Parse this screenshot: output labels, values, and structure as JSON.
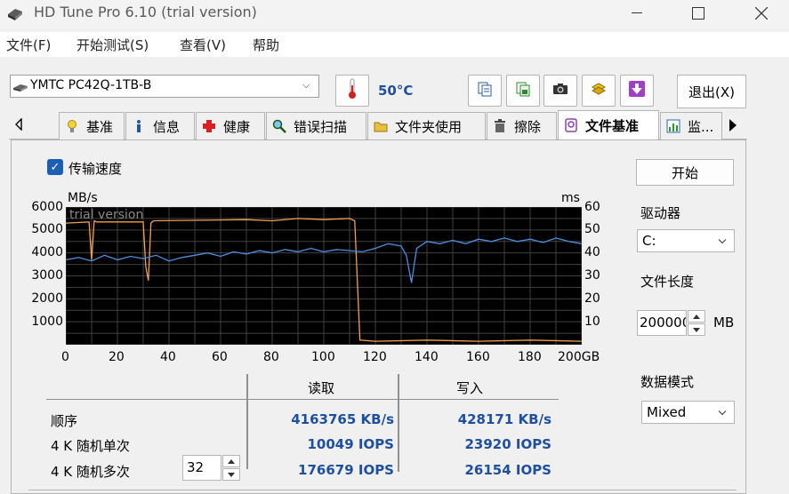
{
  "window": {
    "title": "HD Tune Pro 6.10 (trial version)",
    "minimize_icon": "minimize-icon",
    "maximize_icon": "maximize-icon",
    "close_icon": "close-icon"
  },
  "menu": [
    "文件(F)",
    "开始测试(S)",
    "查看(V)",
    "帮助"
  ],
  "toolbar": {
    "drive": "YMTC PC42Q-1TB-B",
    "temperature": "50°C",
    "exit_label": "退出(X)",
    "icons": [
      "copy-text-icon",
      "copy-image-icon",
      "camera-icon",
      "options-icon",
      "save-icon"
    ]
  },
  "tabs": [
    {
      "label": "基准",
      "icon": "benchmark-icon"
    },
    {
      "label": "信息",
      "icon": "info-icon"
    },
    {
      "label": "健康",
      "icon": "health-icon"
    },
    {
      "label": "错误扫描",
      "icon": "error-scan-icon"
    },
    {
      "label": "文件夹使用",
      "icon": "folder-icon"
    },
    {
      "label": "擦除",
      "icon": "erase-icon"
    },
    {
      "label": "文件基准",
      "icon": "file-benchmark-icon",
      "active": true
    },
    {
      "label": "监...",
      "icon": "monitor-icon"
    }
  ],
  "options": {
    "transfer_speed_label": "传输速度",
    "transfer_speed_checked": true,
    "start_label": "开始",
    "drive_label": "驱动器",
    "drive_value": "C:",
    "file_length_label": "文件长度",
    "file_length_value": "200000",
    "file_length_unit": "MB",
    "data_mode_label": "数据模式",
    "data_mode_value": "Mixed",
    "queue_depth": "32"
  },
  "chart_data": {
    "type": "line",
    "watermark": "trial version",
    "ylabel": "MB/s",
    "y2label": "ms",
    "xlim": [
      0,
      200
    ],
    "ylim": [
      0,
      6000
    ],
    "y2lim": [
      0,
      60
    ],
    "x_ticks": [
      "0",
      "20",
      "40",
      "60",
      "80",
      "100",
      "120",
      "140",
      "160",
      "180",
      "200GB"
    ],
    "y_ticks": [
      "1000",
      "2000",
      "3000",
      "4000",
      "5000",
      "6000"
    ],
    "y2_ticks": [
      "10",
      "20",
      "30",
      "40",
      "50",
      "60"
    ],
    "colors": {
      "write": "#f0a050",
      "read": "#4a90e0",
      "grid": "#404040"
    },
    "series": [
      {
        "color": "#f0a050",
        "x": [
          0,
          9,
          10,
          11,
          12,
          30,
          31,
          32,
          33,
          34,
          70,
          80,
          90,
          100,
          110,
          112,
          114,
          120,
          140,
          160,
          180,
          200
        ],
        "y": [
          5300,
          5350,
          3700,
          5400,
          5350,
          5350,
          3400,
          2800,
          5300,
          5400,
          5450,
          5400,
          5500,
          5450,
          5500,
          5400,
          200,
          150,
          200,
          150,
          200,
          150
        ]
      },
      {
        "color": "#4a90e0",
        "x": [
          0,
          5,
          10,
          15,
          20,
          25,
          30,
          35,
          40,
          45,
          50,
          55,
          60,
          65,
          70,
          75,
          80,
          85,
          90,
          95,
          100,
          105,
          110,
          115,
          120,
          125,
          130,
          132,
          134,
          136,
          140,
          145,
          150,
          155,
          160,
          165,
          170,
          175,
          180,
          185,
          190,
          195,
          200
        ],
        "y": [
          3700,
          3800,
          3650,
          3900,
          3700,
          3850,
          3750,
          3900,
          3650,
          3800,
          3900,
          4000,
          3850,
          4050,
          3950,
          4100,
          4000,
          4150,
          4050,
          4200,
          4050,
          4150,
          4100,
          4050,
          4200,
          4400,
          4300,
          3900,
          2700,
          4200,
          4500,
          4400,
          4550,
          4400,
          4600,
          4500,
          4650,
          4500,
          4600,
          4450,
          4650,
          4500,
          4400
        ]
      }
    ]
  },
  "results": {
    "read_header": "读取",
    "write_header": "写入",
    "rows": [
      {
        "label": "顺序",
        "read": "4163765 KB/s",
        "write": "428171 KB/s"
      },
      {
        "label": "4 K 随机单次",
        "read": "10049 IOPS",
        "write": "23920 IOPS"
      },
      {
        "label": "4 K 随机多次",
        "read": "176679 IOPS",
        "write": "26154 IOPS"
      }
    ]
  }
}
